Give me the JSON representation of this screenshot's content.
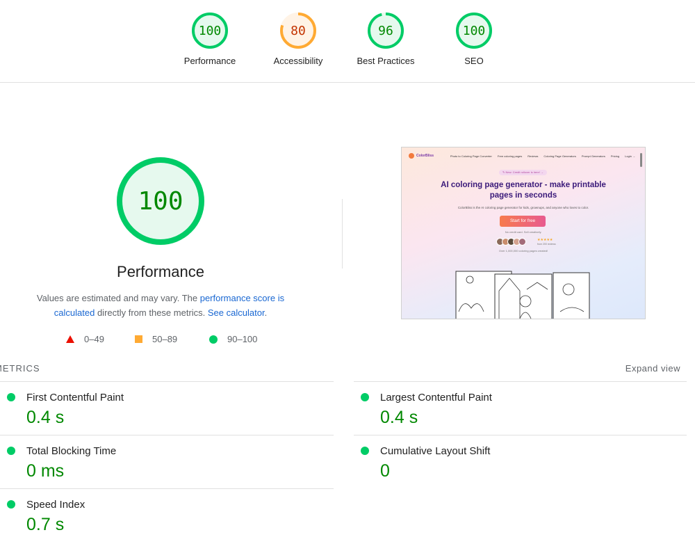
{
  "top_gauges": [
    {
      "score": "100",
      "label": "Performance",
      "fraction": 1.0,
      "color": "#0c6",
      "text_color": "#008800",
      "bg": "#e6f9ee"
    },
    {
      "score": "80",
      "label": "Accessibility",
      "fraction": 0.8,
      "color": "#fa3",
      "text_color": "#c33300",
      "bg": "#fff3e6"
    },
    {
      "score": "96",
      "label": "Best Practices",
      "fraction": 0.96,
      "color": "#0c6",
      "text_color": "#008800",
      "bg": "#e6f9ee"
    },
    {
      "score": "100",
      "label": "SEO",
      "fraction": 1.0,
      "color": "#0c6",
      "text_color": "#008800",
      "bg": "#e6f9ee"
    }
  ],
  "main": {
    "score": "100",
    "fraction": 1.0,
    "title": "Performance",
    "desc_prefix": "Values are estimated and may vary. The ",
    "desc_link1": "performance score is calculated",
    "desc_middle": " directly from these metrics. ",
    "desc_link2": "See calculator",
    "desc_suffix": "."
  },
  "legend": {
    "fail": "0–49",
    "average": "50–89",
    "pass": "90–100"
  },
  "thumbnail": {
    "logo": "ColorBliss",
    "nav_links": [
      "Photo to Coloring Page Converter",
      "Free coloring pages",
      "Reviews",
      "Coloring Page Generators",
      "Prompt Generators",
      "Pricing",
      "Login →"
    ],
    "pill": "✎ New: Credit rollover is here! →",
    "headline": "AI coloring page generator - make printable pages in seconds",
    "sub": "ColorBliss is the AI coloring page generator for kids, grownups, and anyone who loves to color.",
    "cta": "Start for free",
    "note": "No credit card. Sell creatively.",
    "stars": "★★★★★",
    "reviews": "from 200 reviews",
    "count": "Over 1,000,000 coloring pages created!"
  },
  "metrics": {
    "heading": "METRICS",
    "expand": "Expand view",
    "items": [
      {
        "name": "First Contentful Paint",
        "value": "0.4 s"
      },
      {
        "name": "Largest Contentful Paint",
        "value": "0.4 s"
      },
      {
        "name": "Total Blocking Time",
        "value": "0 ms"
      },
      {
        "name": "Cumulative Layout Shift",
        "value": "0"
      },
      {
        "name": "Speed Index",
        "value": "0.7 s"
      }
    ]
  }
}
